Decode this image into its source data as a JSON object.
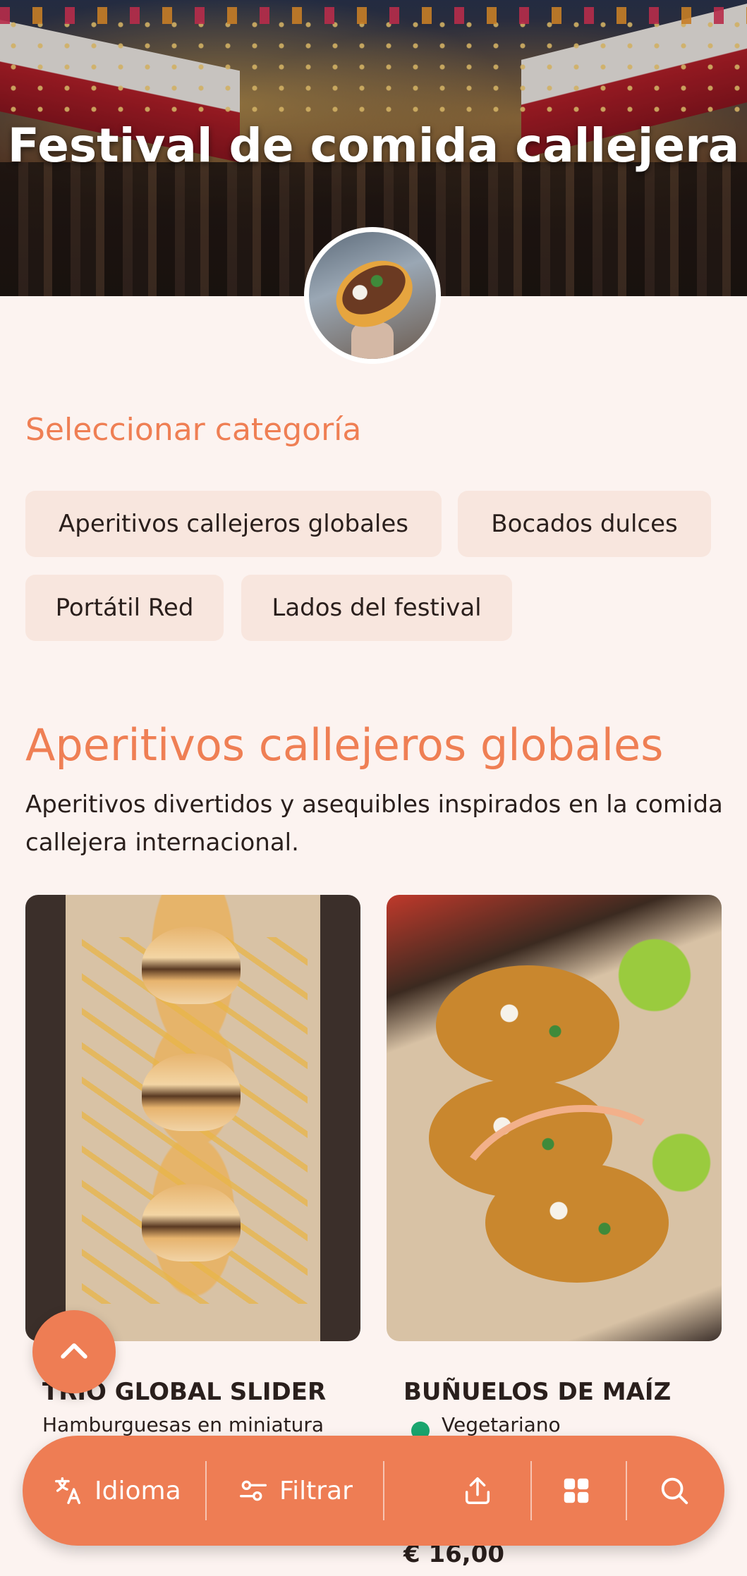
{
  "hero": {
    "title": "Festival de comida callejera"
  },
  "categories": {
    "heading": "Seleccionar categoría",
    "chips": [
      "Aperitivos callejeros globales",
      "Bocados dulces",
      "Portátil Red",
      "Lados del festival"
    ]
  },
  "section": {
    "title": "Aperitivos callejeros globales",
    "description": "Aperitivos divertidos y asequibles inspirados en la comida callejera internacional."
  },
  "cards": [
    {
      "name": "TRIO GLOBAL SLIDER",
      "subtitle": "Hamburguesas en miniatura"
    },
    {
      "name": "BUÑUELOS DE MAÍZ",
      "tag": "Vegetariano",
      "price": "€ 16,00"
    }
  ],
  "bottom_bar": {
    "language_label": "Idioma",
    "filter_label": "Filtrar"
  },
  "colors": {
    "accent": "#ee7d54",
    "background": "#fcf3f0",
    "chip": "#f8e6de",
    "veg": "#1aa56e"
  }
}
